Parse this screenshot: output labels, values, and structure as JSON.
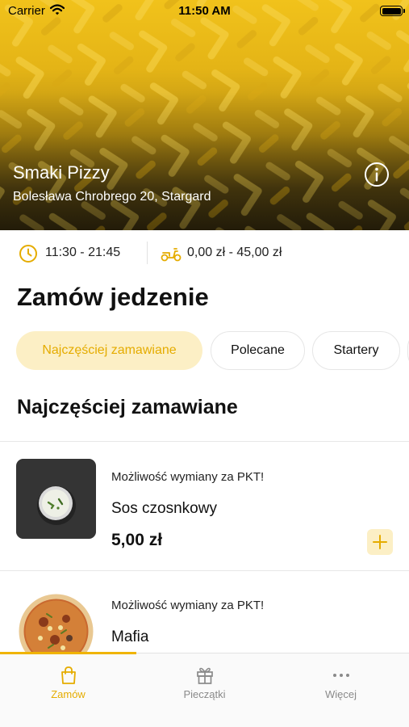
{
  "status_bar": {
    "carrier": "Carrier",
    "time": "11:50 AM"
  },
  "hero": {
    "name": "Smaki Pizzy",
    "address": "Bolesława Chrobrego 20, Stargard"
  },
  "info": {
    "hours": "11:30 - 21:45",
    "delivery_cost": "0,00 zł - 45,00 zł"
  },
  "section_title": "Zamów jedzenie",
  "categories": [
    {
      "label": "Najczęściej zamawiane",
      "active": true
    },
    {
      "label": "Polecane",
      "active": false
    },
    {
      "label": "Startery",
      "active": false
    }
  ],
  "list_heading": "Najczęściej zamawiane",
  "products": [
    {
      "tag": "Możliwość wymiany za PKT!",
      "name": "Sos czosnkowy",
      "price": "5,00 zł"
    },
    {
      "tag": "Możliwość wymiany za PKT!",
      "name": "Mafia"
    }
  ],
  "tabs": [
    {
      "label": "Zamów",
      "active": true,
      "icon": "bag-icon"
    },
    {
      "label": "Pieczątki",
      "active": false,
      "icon": "gift-icon"
    },
    {
      "label": "Więcej",
      "active": false,
      "icon": "more-icon"
    }
  ],
  "colors": {
    "accent": "#e5ac00",
    "accent_light": "#fcefc5",
    "hero": "#f1c21b"
  }
}
